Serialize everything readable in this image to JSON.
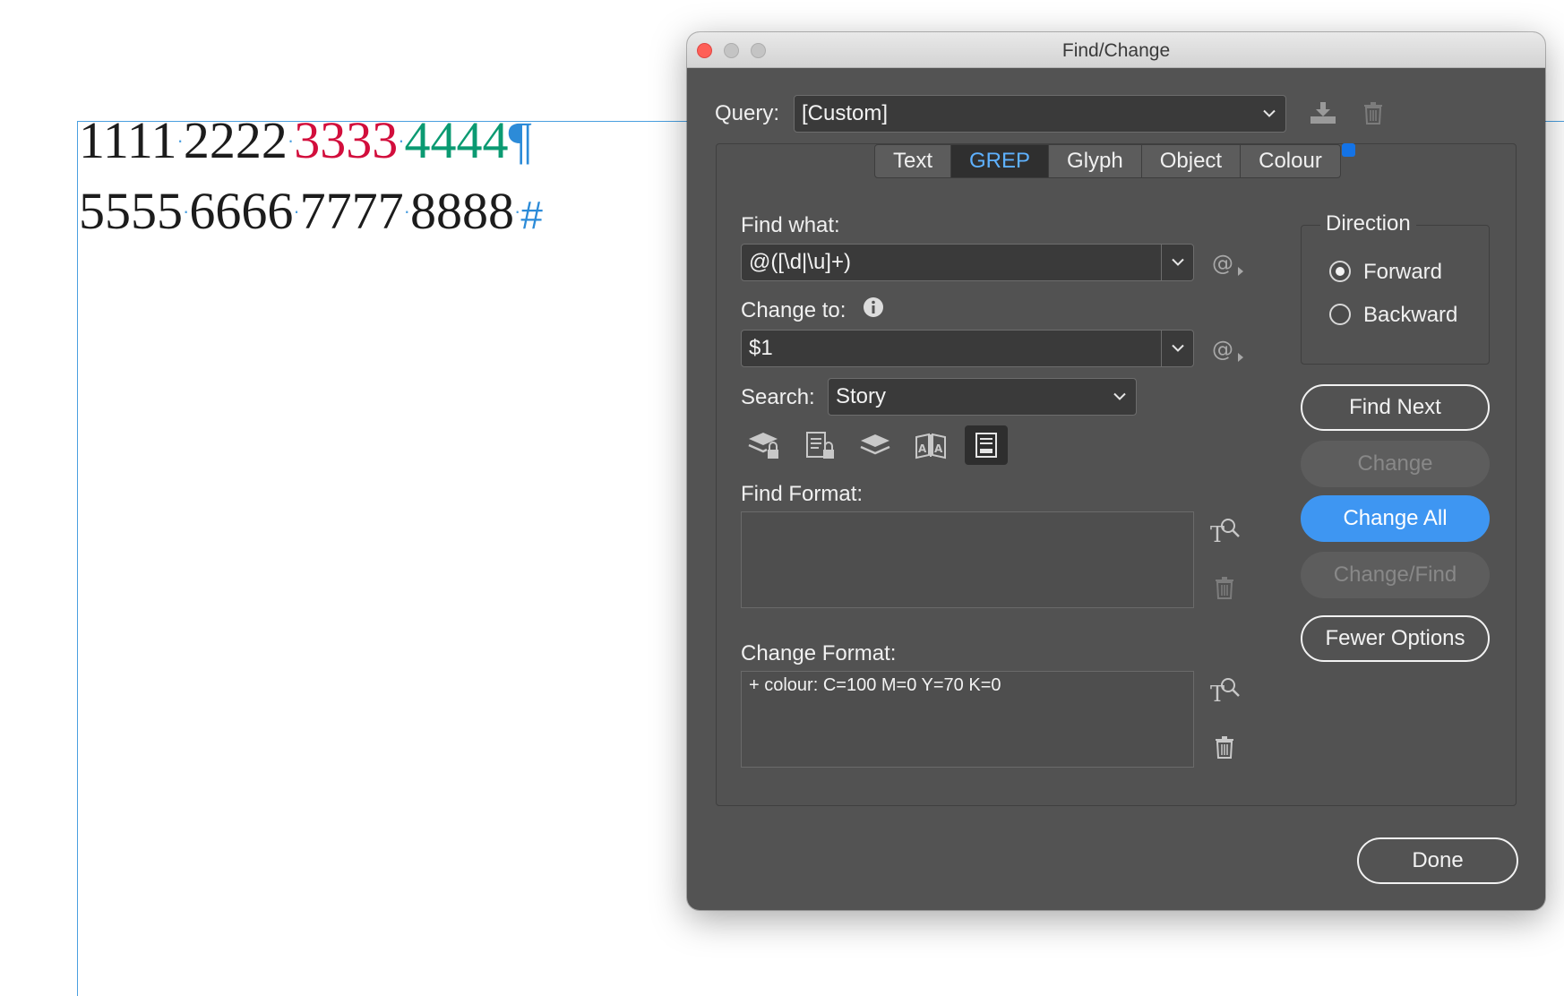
{
  "document": {
    "line1": {
      "g1": "1111",
      "g2": "2222",
      "g3": "3333",
      "g4": "4444",
      "end_mark": "¶"
    },
    "line2": {
      "g1": "5555",
      "g2": "6666",
      "g3": "7777",
      "g4": "8888",
      "end_mark": "#"
    },
    "space_marker": "·",
    "colors": {
      "red": "#d20e3c",
      "green": "#0b9a72",
      "guide": "#4a9fe0"
    }
  },
  "dialog": {
    "title": "Find/Change",
    "query": {
      "label": "Query:",
      "value": "[Custom]"
    },
    "tabs": [
      {
        "label": "Text",
        "active": false
      },
      {
        "label": "GREP",
        "active": true
      },
      {
        "label": "Glyph",
        "active": false
      },
      {
        "label": "Object",
        "active": false
      },
      {
        "label": "Colour",
        "active": false
      }
    ],
    "find_what": {
      "label": "Find what:",
      "value": "@([\\d|\\u]+)"
    },
    "change_to": {
      "label": "Change to:",
      "value": "$1"
    },
    "search": {
      "label": "Search:",
      "value": "Story"
    },
    "find_format": {
      "label": "Find Format:",
      "value": ""
    },
    "change_format": {
      "label": "Change Format:",
      "value": "+ colour: C=100 M=0 Y=70 K=0"
    },
    "direction": {
      "legend": "Direction",
      "options": [
        {
          "label": "Forward",
          "selected": true
        },
        {
          "label": "Backward",
          "selected": false
        }
      ]
    },
    "buttons": {
      "find_next": "Find Next",
      "change": "Change",
      "change_all": "Change All",
      "change_find": "Change/Find",
      "fewer_options": "Fewer Options",
      "done": "Done"
    },
    "icons": {
      "save_query": "save-query-icon",
      "delete_query": "trash-icon",
      "special_chars": "at-sign-menu-icon",
      "include_locked_layers": "locked-layers-icon",
      "include_locked_stories": "locked-stories-icon",
      "include_hidden_layers": "hidden-layers-icon",
      "include_master_pages": "master-pages-icon",
      "include_footnotes": "footnotes-icon",
      "specify_format": "format-search-icon",
      "clear_format": "trash-icon",
      "info": "info-icon"
    },
    "colors": {
      "accent": "#3e96f2",
      "active_tab_text": "#5eb1ff",
      "panel_bg": "#535353"
    }
  }
}
